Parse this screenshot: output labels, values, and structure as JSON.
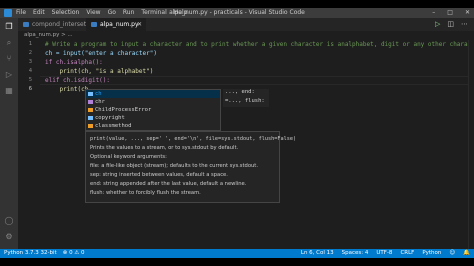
{
  "window": {
    "title": "alpa_num.py - practicals - Visual Studio Code",
    "menu": [
      "File",
      "Edit",
      "Selection",
      "View",
      "Go",
      "Run",
      "Terminal",
      "Help"
    ],
    "controls": [
      "–",
      "□",
      "✕"
    ]
  },
  "tabs": [
    {
      "label": "compond_interset.py",
      "active": false
    },
    {
      "label": "alpa_num.py",
      "active": true,
      "close": "✕"
    }
  ],
  "tab_actions": {
    "run_icon": "run-icon",
    "split_icon": "split-editor-icon",
    "more_icon": "more-icon"
  },
  "breadcrumb": "alpa_num.py > ...",
  "editor": {
    "line_numbers": [
      "1",
      "2",
      "3",
      "4",
      "5",
      "6"
    ],
    "lines": [
      "# Write a program to input a character and to print whether a given character is analphabet, digit or any other charac",
      "ch = input(\"enter a character\")",
      "if ch.isalpha():",
      "    print(ch, \"is a alphabet\")",
      "elif ch.isdigit():",
      "    print(ch"
    ]
  },
  "suggestions": [
    {
      "label": "ch",
      "kind": "variable",
      "selected": true
    },
    {
      "label": "chr",
      "kind": "function",
      "selected": false
    },
    {
      "label": "ChildProcessError",
      "kind": "class",
      "selected": false
    },
    {
      "label": "copyright",
      "kind": "variable",
      "selected": false
    },
    {
      "label": "classmethod",
      "kind": "class",
      "selected": false
    }
  ],
  "param_hint": {
    "line1": "..., end:",
    "line2": "=..., flush:"
  },
  "doc": {
    "signature": "print(value, ..., sep=' ', end='\\n', file=sys.stdout, flush=False)",
    "lines": [
      "Prints the values to a stream, or to sys.stdout by default.",
      "Optional keyword arguments:",
      "file:  a file-like object (stream); defaults to the current sys.stdout.",
      "sep:   string inserted between values, default a space.",
      "end:   string appended after the last value, default a newline.",
      "flush: whether to forcibly flush the stream."
    ]
  },
  "status": {
    "left": [
      "Python 3.7.3 32-bit",
      "⊗ 0 ⚠ 0"
    ],
    "right": [
      "Ln 6, Col 13",
      "Spaces: 4",
      "UTF-8",
      "CRLF",
      "Python",
      "☺",
      "🔔"
    ]
  },
  "colors": {
    "statusbar": "#007acc",
    "editor_bg": "#1e1e1e",
    "titlebar": "#3c3c3c"
  }
}
